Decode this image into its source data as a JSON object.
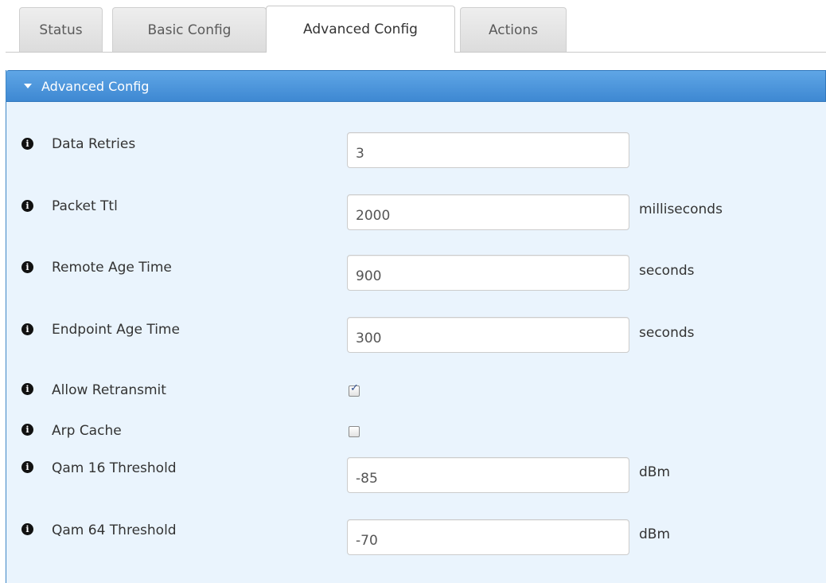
{
  "tabs": [
    {
      "label": "Status"
    },
    {
      "label": "Basic Config"
    },
    {
      "label": "Advanced Config",
      "active": true
    },
    {
      "label": "Actions"
    }
  ],
  "panel": {
    "title": "Advanced Config"
  },
  "info_icon_glyph": "i",
  "fields": {
    "data_retries": {
      "label": "Data Retries",
      "value": "3",
      "unit": ""
    },
    "packet_ttl": {
      "label": "Packet Ttl",
      "value": "2000",
      "unit": "milliseconds"
    },
    "remote_age_time": {
      "label": "Remote Age Time",
      "value": "900",
      "unit": "seconds"
    },
    "endpoint_age_time": {
      "label": "Endpoint Age Time",
      "value": "300",
      "unit": "seconds"
    },
    "allow_retransmit": {
      "label": "Allow Retransmit",
      "checked": true
    },
    "arp_cache": {
      "label": "Arp Cache",
      "checked": false
    },
    "qam16_threshold": {
      "label": "Qam 16 Threshold",
      "value": "-85",
      "unit": "dBm"
    },
    "qam64_threshold": {
      "label": "Qam 64 Threshold",
      "value": "-70",
      "unit": "dBm"
    }
  },
  "colors": {
    "header_blue": "#4a92d8",
    "panel_bg": "#eaf4fd",
    "checkbox_tick": "#2f4f8f"
  },
  "icons": {
    "info": "info-circle-icon",
    "caret": "caret-down-icon",
    "check": "check-icon"
  }
}
